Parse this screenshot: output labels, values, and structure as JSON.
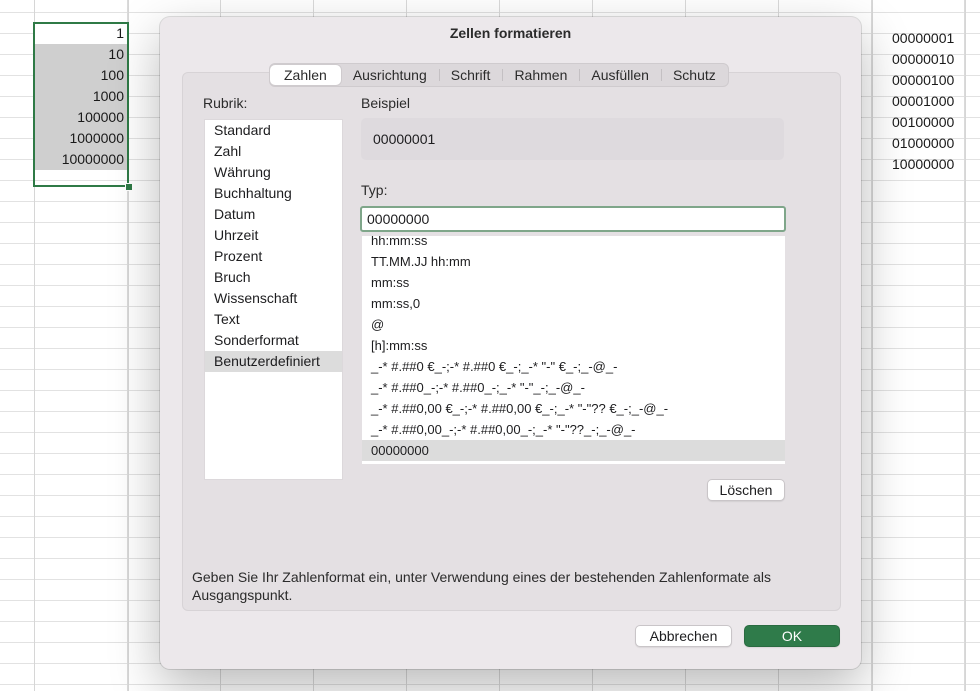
{
  "sheet": {
    "column_a": [
      "1",
      "10",
      "100",
      "1000",
      "100000",
      "1000000",
      "10000000"
    ],
    "column_right": [
      "00000001",
      "00000010",
      "00000100",
      "00001000",
      "00100000",
      "01000000",
      "10000000"
    ]
  },
  "dialog": {
    "title": "Zellen formatieren",
    "tabs": [
      "Zahlen",
      "Ausrichtung",
      "Schrift",
      "Rahmen",
      "Ausfüllen",
      "Schutz"
    ],
    "active_tab": "Zahlen",
    "category_label": "Rubrik:",
    "categories": [
      "Standard",
      "Zahl",
      "Währung",
      "Buchhaltung",
      "Datum",
      "Uhrzeit",
      "Prozent",
      "Bruch",
      "Wissenschaft",
      "Text",
      "Sonderformat",
      "Benutzerdefiniert"
    ],
    "selected_category": "Benutzerdefiniert",
    "sample_label": "Beispiel",
    "sample_value": "00000001",
    "type_label": "Typ:",
    "type_value": "00000000",
    "formats": [
      "hh:mm:ss",
      "TT.MM.JJ hh:mm",
      "mm:ss",
      "mm:ss,0",
      "@",
      "[h]:mm:ss",
      "_-* #.##0 €_-;-* #.##0 €_-;_-* \"-\" €_-;_-@_-",
      "_-* #.##0_-;-* #.##0_-;_-* \"-\"_-;_-@_-",
      "_-* #.##0,00 €_-;-* #.##0,00 €_-;_-* \"-\"?? €_-;_-@_-",
      "_-* #.##0,00_-;-* #.##0,00_-;_-* \"-\"??_-;_-@_-",
      "00000000"
    ],
    "selected_format": "00000000",
    "delete_label": "Löschen",
    "hint": "Geben Sie Ihr Zahlenformat ein, unter Verwendung eines der bestehenden Zahlenformate als Ausgangspunkt.",
    "cancel_label": "Abbrechen",
    "ok_label": "OK",
    "accent_color": "#2f7b4a"
  }
}
